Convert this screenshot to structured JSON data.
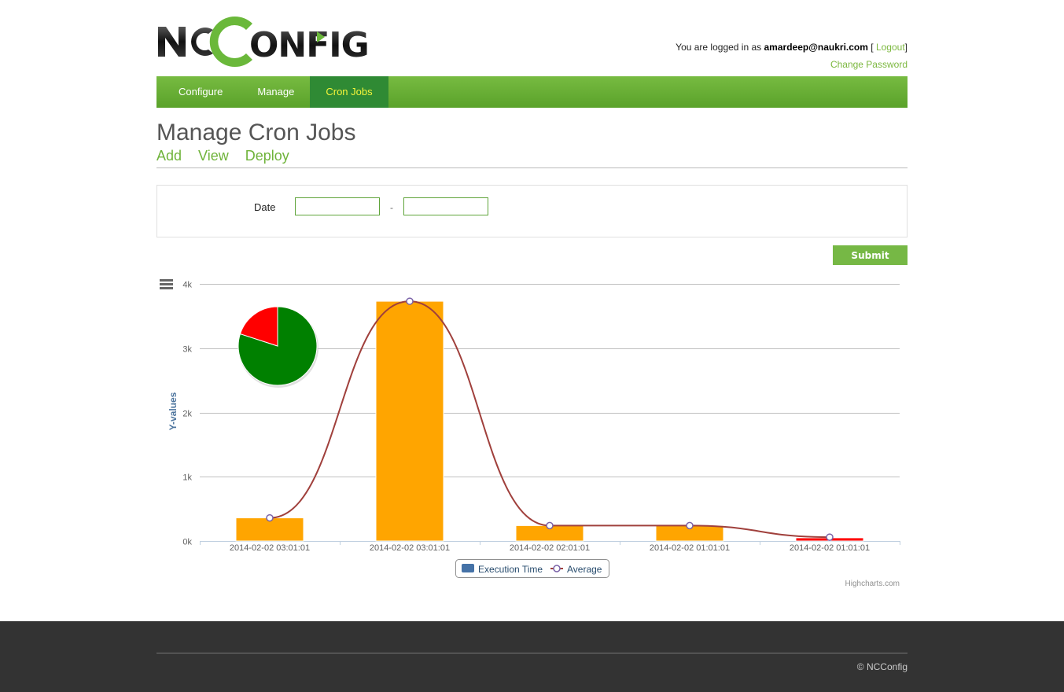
{
  "header": {
    "logo_text": "NCCONFIG",
    "login_prefix": "You are logged in as",
    "username": "amardeep@naukri.com",
    "logout_label": "Logout",
    "change_password_label": "Change Password"
  },
  "nav": {
    "tabs": [
      {
        "label": "Configure"
      },
      {
        "label": "Manage"
      },
      {
        "label": "Cron Jobs"
      }
    ],
    "active": "Cron Jobs"
  },
  "page": {
    "title": "Manage Cron Jobs",
    "subnav": [
      {
        "label": "Add"
      },
      {
        "label": "View"
      },
      {
        "label": "Deploy"
      }
    ]
  },
  "form": {
    "date_label": "Date",
    "separator": "-",
    "date_from_value": "",
    "date_to_value": "",
    "submit_label": "Submit"
  },
  "chart_data": {
    "type": "bar",
    "ylabel": "Y-values",
    "ylim": [
      0,
      4000
    ],
    "yticks": [
      "0k",
      "1k",
      "2k",
      "3k",
      "4k"
    ],
    "categories": [
      "2014-02-02 03:01:01",
      "2014-02-02 03:01:01",
      "2014-02-02 02:01:01",
      "2014-02-02 01:01:01",
      "2014-02-02 01:01:01"
    ],
    "series": [
      {
        "name": "Execution Time",
        "kind": "bar",
        "values": [
          360,
          3730,
          240,
          240,
          50
        ],
        "colors": [
          "#ffa500",
          "#ffa500",
          "#ffa500",
          "#ffa500",
          "#ff0000"
        ]
      },
      {
        "name": "Average",
        "kind": "spline",
        "values": [
          360,
          3730,
          240,
          240,
          60
        ],
        "color": "#a0403c"
      }
    ],
    "pie": {
      "slices": [
        {
          "value": 80,
          "color": "#008000"
        },
        {
          "value": 20,
          "color": "#ff0000"
        }
      ]
    },
    "legend_placement": "bottom-center",
    "credit": "Highcharts.com",
    "legend_swatch_color": "#4572a7",
    "grid": true
  },
  "footer": {
    "copyright": "© NCConfig"
  },
  "colors": {
    "brand_green": "#6fb33a",
    "nav_active": "#2f8a34",
    "footer_bg": "#333333"
  }
}
